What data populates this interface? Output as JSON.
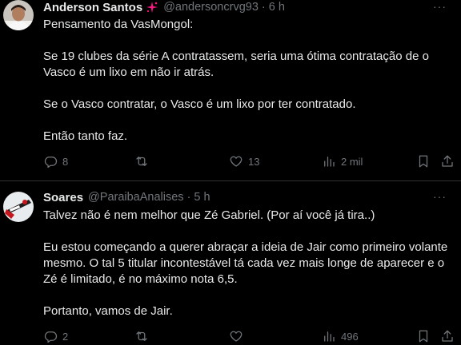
{
  "colors": {
    "background": "#000000",
    "text_primary": "#e7e9ea",
    "text_secondary": "#71767b",
    "divider": "#2f3336"
  },
  "tweets": [
    {
      "author": "Anderson Santos",
      "badge_icon": "sparkle-badge-icon",
      "handle": "@andersoncrvg93",
      "dot": "·",
      "time": "6 h",
      "more": "···",
      "paragraphs": [
        "Pensamento da VasMongol:",
        "Se 19 clubes da série A contratassem, seria uma ótima contratação de o Vasco é um lixo em não ir atrás.",
        "Se o Vasco contratar, o Vasco é um lixo por ter contratado.",
        "Então tanto faz."
      ],
      "replies": "8",
      "retweets": "",
      "likes": "13",
      "views": "2 mil"
    },
    {
      "author": "Soares",
      "handle": "@ParaibaAnalises",
      "dot": "·",
      "time": "5 h",
      "more": "···",
      "paragraphs": [
        "Talvez não é nem melhor que Zé Gabriel. (Por aí você já tira..)",
        "Eu estou começando a querer abraçar a ideia de Jair como primeiro volante mesmo. O tal 5 titular incontestável tá cada vez mais longe de aparecer e o Zé é limitado, é no máximo nota 6,5.",
        "Portanto, vamos de Jair."
      ],
      "replies": "2",
      "retweets": "",
      "likes": "",
      "views": "496"
    }
  ]
}
